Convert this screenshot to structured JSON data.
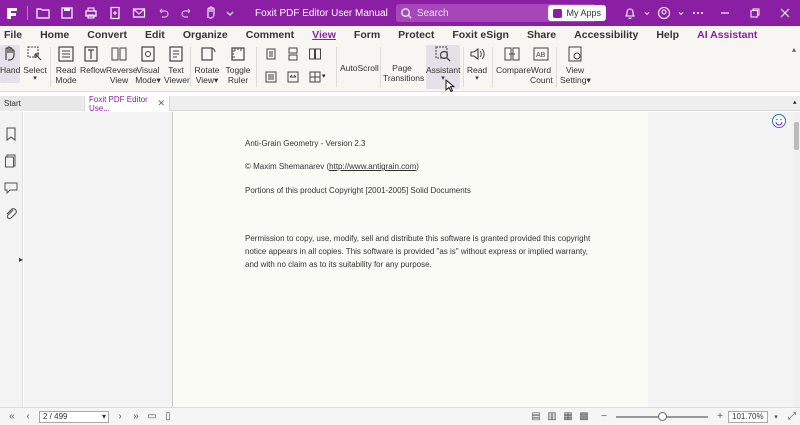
{
  "titlebar": {
    "title": "Foxit PDF Editor User Manual",
    "search_placeholder": "Search",
    "my_apps_label": "My Apps"
  },
  "menu": [
    "File",
    "Home",
    "Convert",
    "Edit",
    "Organize",
    "Comment",
    "View",
    "Form",
    "Protect",
    "Foxit eSign",
    "Share",
    "Accessibility",
    "Help",
    "AI Assistant"
  ],
  "menu_active": "View",
  "ribbon": {
    "hand": "Hand",
    "select": "Select",
    "read_mode": [
      "Read",
      "Mode"
    ],
    "reflow": "Reflow",
    "reverse_view": [
      "Reverse",
      "View"
    ],
    "visual_mode": [
      "Visual",
      "Mode"
    ],
    "text_viewer": [
      "Text",
      "Viewer"
    ],
    "rotate_view": [
      "Rotate",
      "View"
    ],
    "toggle_ruler": [
      "Toggle",
      "Ruler"
    ],
    "autoscroll": "AutoScroll",
    "page_transitions": [
      "Page",
      "Transitions"
    ],
    "assistant": "Assistant",
    "read": "Read",
    "compare": "Compare",
    "word_count": [
      "Word",
      "Count"
    ],
    "view_setting": [
      "View",
      "Setting"
    ]
  },
  "tabs": {
    "start": "Start",
    "doc": "Foxit PDF Editor Use..."
  },
  "document": {
    "line1": "Anti-Grain Geometry - Version 2.3",
    "line2_prefix": "© Maxim Shemanarev (",
    "line2_link": "http://www.antigrain.com",
    "line2_suffix": ")",
    "line3": "Portions of this product Copyright [2001-2005] Solid Documents",
    "para1": "Permission to copy, use, modify, sell and distribute this software is granted provided this copyright",
    "para2": "notice appears in all copies. This software is provided \"as is\" without express or implied warranty,",
    "para3": "and with no claim as to its suitability for any purpose."
  },
  "statusbar": {
    "page_value": "2 / 499",
    "zoom_value": "101.70%"
  },
  "colors": {
    "brand": "#8b1fa3",
    "ribbon_bg": "#f7f6f3",
    "page_bg": "#fbfbf6"
  }
}
